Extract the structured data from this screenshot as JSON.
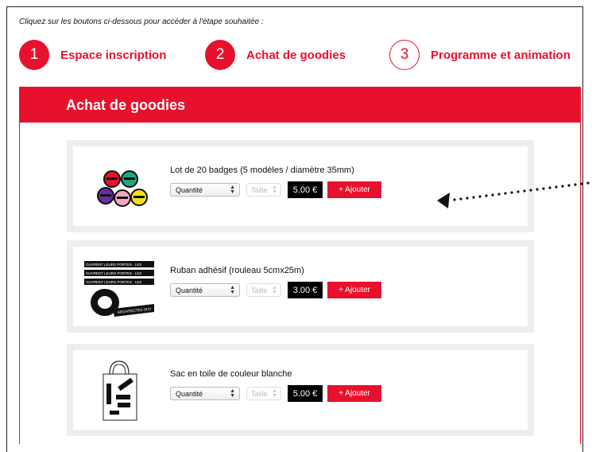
{
  "instruction": "Cliquez sur les boutons ci-dessous pour accéder à l'étape souhaitée :",
  "steps": [
    {
      "number": "1",
      "label": "Espace inscription"
    },
    {
      "number": "2",
      "label": "Achat de goodies"
    },
    {
      "number": "3",
      "label": "Programme et animation"
    }
  ],
  "section_title": "Achat de goodies",
  "products": [
    {
      "title": "Lot de 20 badges (5 modèles / diamètre 35mm)",
      "quantity_label": "Quantité",
      "size_label": "Taille",
      "price": "5.00 €",
      "add_label": "+ Ajouter",
      "image_icon": "badges-icon"
    },
    {
      "title": "Ruban adhésif (rouleau 5cmx25m)",
      "quantity_label": "Quantité",
      "size_label": "Taille",
      "price": "3.00 €",
      "add_label": "+ Ajouter",
      "image_icon": "tape-roll-icon",
      "image_text": {
        "strip": "OUVRENT LEURS PORTES · LES",
        "roll": "ARCHITECTES OUV"
      }
    },
    {
      "title": "Sac en toile de couleur blanche",
      "quantity_label": "Quantité",
      "size_label": "Taille",
      "price": "5.00 €",
      "add_label": "+ Ajouter",
      "image_icon": "tote-bag-icon"
    }
  ],
  "colors": {
    "accent": "#e8112d",
    "price_bg": "#000000",
    "card_border": "#eeeeee"
  }
}
